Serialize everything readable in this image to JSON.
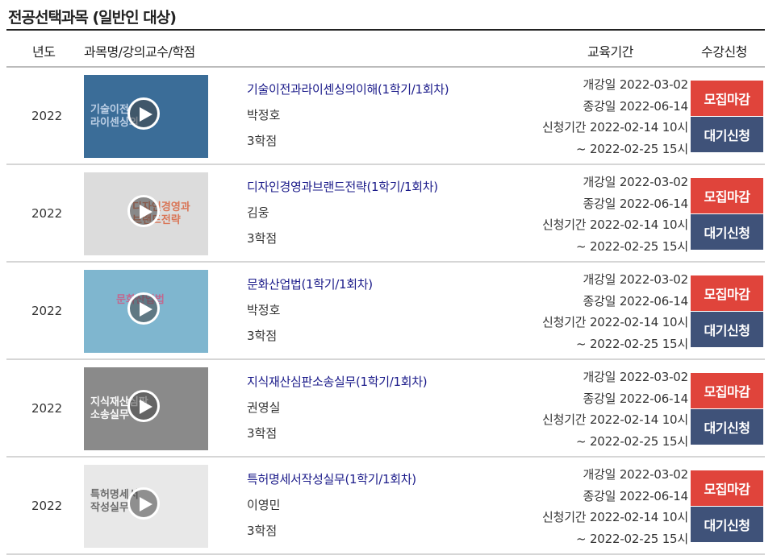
{
  "section": {
    "title": "전공선택과목  (일반인 대상)"
  },
  "table": {
    "headers": {
      "year": "년도",
      "course": "과목명/강의교수/학점",
      "period": "교육기간",
      "apply": "수강신청"
    },
    "rows": [
      {
        "year": "2022",
        "thumb_text": "기술이전\n라이센싱의",
        "title": "기술이전과라이센싱의이해(1학기/1회차)",
        "professor": "박정호",
        "credit": "3학점",
        "start": "개강일 2022-03-02",
        "end": "종강일 2022-06-14",
        "apply_period": "신청기간 2022-02-14 10시",
        "apply_until": "~ 2022-02-25 15시",
        "closed_label": "모집마감",
        "wait_label": "대기신청"
      },
      {
        "year": "2022",
        "thumb_text": "디자인경영과\n브랜드전략",
        "title": "디자인경영과브랜드전략(1학기/1회차)",
        "professor": "김웅",
        "credit": "3학점",
        "start": "개강일 2022-03-02",
        "end": "종강일 2022-06-14",
        "apply_period": "신청기간 2022-02-14 10시",
        "apply_until": "~ 2022-02-25 15시",
        "closed_label": "모집마감",
        "wait_label": "대기신청"
      },
      {
        "year": "2022",
        "thumb_text": "문화산업법",
        "title": "문화산업법(1학기/1회차)",
        "professor": "박정호",
        "credit": "3학점",
        "start": "개강일 2022-03-02",
        "end": "종강일 2022-06-14",
        "apply_period": "신청기간 2022-02-14 10시",
        "apply_until": "~ 2022-02-25 15시",
        "closed_label": "모집마감",
        "wait_label": "대기신청"
      },
      {
        "year": "2022",
        "thumb_text": "지식재산심판\n소송실무",
        "title": "지식재산심판소송실무(1학기/1회차)",
        "professor": "권영실",
        "credit": "3학점",
        "start": "개강일 2022-03-02",
        "end": "종강일 2022-06-14",
        "apply_period": "신청기간 2022-02-14 10시",
        "apply_until": "~ 2022-02-25 15시",
        "closed_label": "모집마감",
        "wait_label": "대기신청"
      },
      {
        "year": "2022",
        "thumb_text": "특허명세서\n작성실무",
        "title": "특허명세서작성실무(1학기/1회차)",
        "professor": "이영민",
        "credit": "3학점",
        "start": "개강일 2022-03-02",
        "end": "종강일 2022-06-14",
        "apply_period": "신청기간 2022-02-14 10시",
        "apply_until": "~ 2022-02-25 15시",
        "closed_label": "모집마감",
        "wait_label": "대기신청"
      }
    ]
  },
  "icons": {
    "thumbnail_overlay": "play-icon"
  },
  "colors": {
    "title_link": "#1b1b8a",
    "closed_button": "#e0443b",
    "wait_button": "#3f5279",
    "thumb_backgrounds": [
      "#3b6d98",
      "#dcdcdc",
      "#7fb6cf",
      "#8a8a8a",
      "#e8e8e8"
    ]
  }
}
